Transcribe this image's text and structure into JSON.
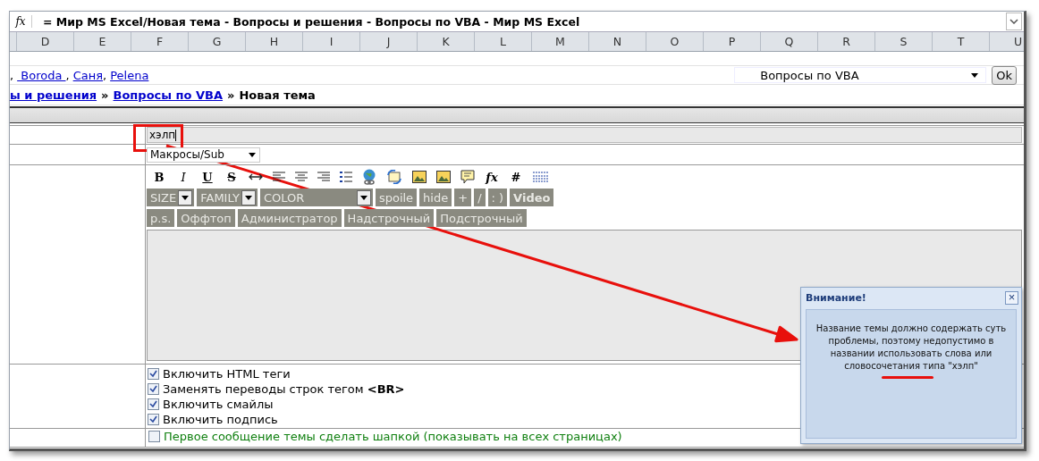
{
  "formula_bar": {
    "function_label": "fx",
    "text": "= Мир MS Excel/Новая тема - Вопросы и решения - Вопросы по VBA - Мир MS Excel"
  },
  "columns": [
    "D",
    "E",
    "F",
    "G",
    "H",
    "I",
    "J",
    "K",
    "L",
    "M",
    "N",
    "O",
    "P",
    "Q",
    "R",
    "S",
    "T",
    "U"
  ],
  "user_links": {
    "leading": ",",
    "names": [
      " Boroda ",
      "Саня",
      "Pelena"
    ]
  },
  "forum_select": {
    "value": "Вопросы по VBA",
    "button": "Ok"
  },
  "breadcrumb": [
    {
      "text": "ы и решения",
      "kind": "link"
    },
    {
      "text": "Вопросы по VBA",
      "kind": "link"
    },
    {
      "text": "Новая тема",
      "kind": "current"
    }
  ],
  "breadcrumb_separator": "»",
  "form": {
    "title_field": {
      "value": "хэлп"
    },
    "section_select": {
      "value": "Макросы/Sub"
    },
    "format_buttons": [
      {
        "kind": "bold",
        "label": "B"
      },
      {
        "kind": "italic",
        "label": "I"
      },
      {
        "kind": "underline",
        "label": "U"
      },
      {
        "kind": "strike",
        "label": "S"
      },
      {
        "kind": "arrows"
      },
      {
        "kind": "align-left"
      },
      {
        "kind": "align-center"
      },
      {
        "kind": "align-right"
      },
      {
        "kind": "list"
      },
      {
        "kind": "globe"
      },
      {
        "kind": "image-swap"
      },
      {
        "kind": "picture"
      },
      {
        "kind": "picture"
      },
      {
        "kind": "comment"
      },
      {
        "kind": "function",
        "label": "fx"
      },
      {
        "kind": "hash",
        "label": "#"
      },
      {
        "kind": "rule"
      }
    ],
    "tag_row_1": [
      {
        "kind": "select",
        "label": "SIZE"
      },
      {
        "kind": "select",
        "label": "FAMILY"
      },
      {
        "kind": "select",
        "label": "COLOR"
      },
      {
        "kind": "button",
        "label": "spoile"
      },
      {
        "kind": "button",
        "label": "hide"
      },
      {
        "kind": "button",
        "label": "+"
      },
      {
        "kind": "button",
        "label": "/"
      },
      {
        "kind": "button",
        "label": ": )"
      },
      {
        "kind": "bold-button",
        "label": "Video"
      }
    ],
    "tag_row_2": [
      {
        "kind": "button",
        "label": "p.s."
      },
      {
        "kind": "button",
        "label": "Оффтоп"
      },
      {
        "kind": "button",
        "label": "Администратор"
      },
      {
        "kind": "button",
        "label": "Надстрочный"
      },
      {
        "kind": "button",
        "label": "Подстрочный"
      }
    ],
    "options": [
      {
        "label": "Включить HTML теги",
        "checked": true
      },
      {
        "label": "Заменять переводы строк тегом **<BR>**",
        "checked": true
      },
      {
        "label": "Включить смайлы",
        "checked": true
      },
      {
        "label": "Включить подпись",
        "checked": true
      }
    ],
    "last_option": {
      "label": "Первое сообщение темы сделать шапкой (показывать на всех страницах)",
      "checked": false
    }
  },
  "popup": {
    "title": "Внимание!",
    "close": "×",
    "message": "Название темы должно содержать суть проблемы, поэтому недопустимо в названии использовать слова или словосочетания типа \"хэлп\""
  }
}
